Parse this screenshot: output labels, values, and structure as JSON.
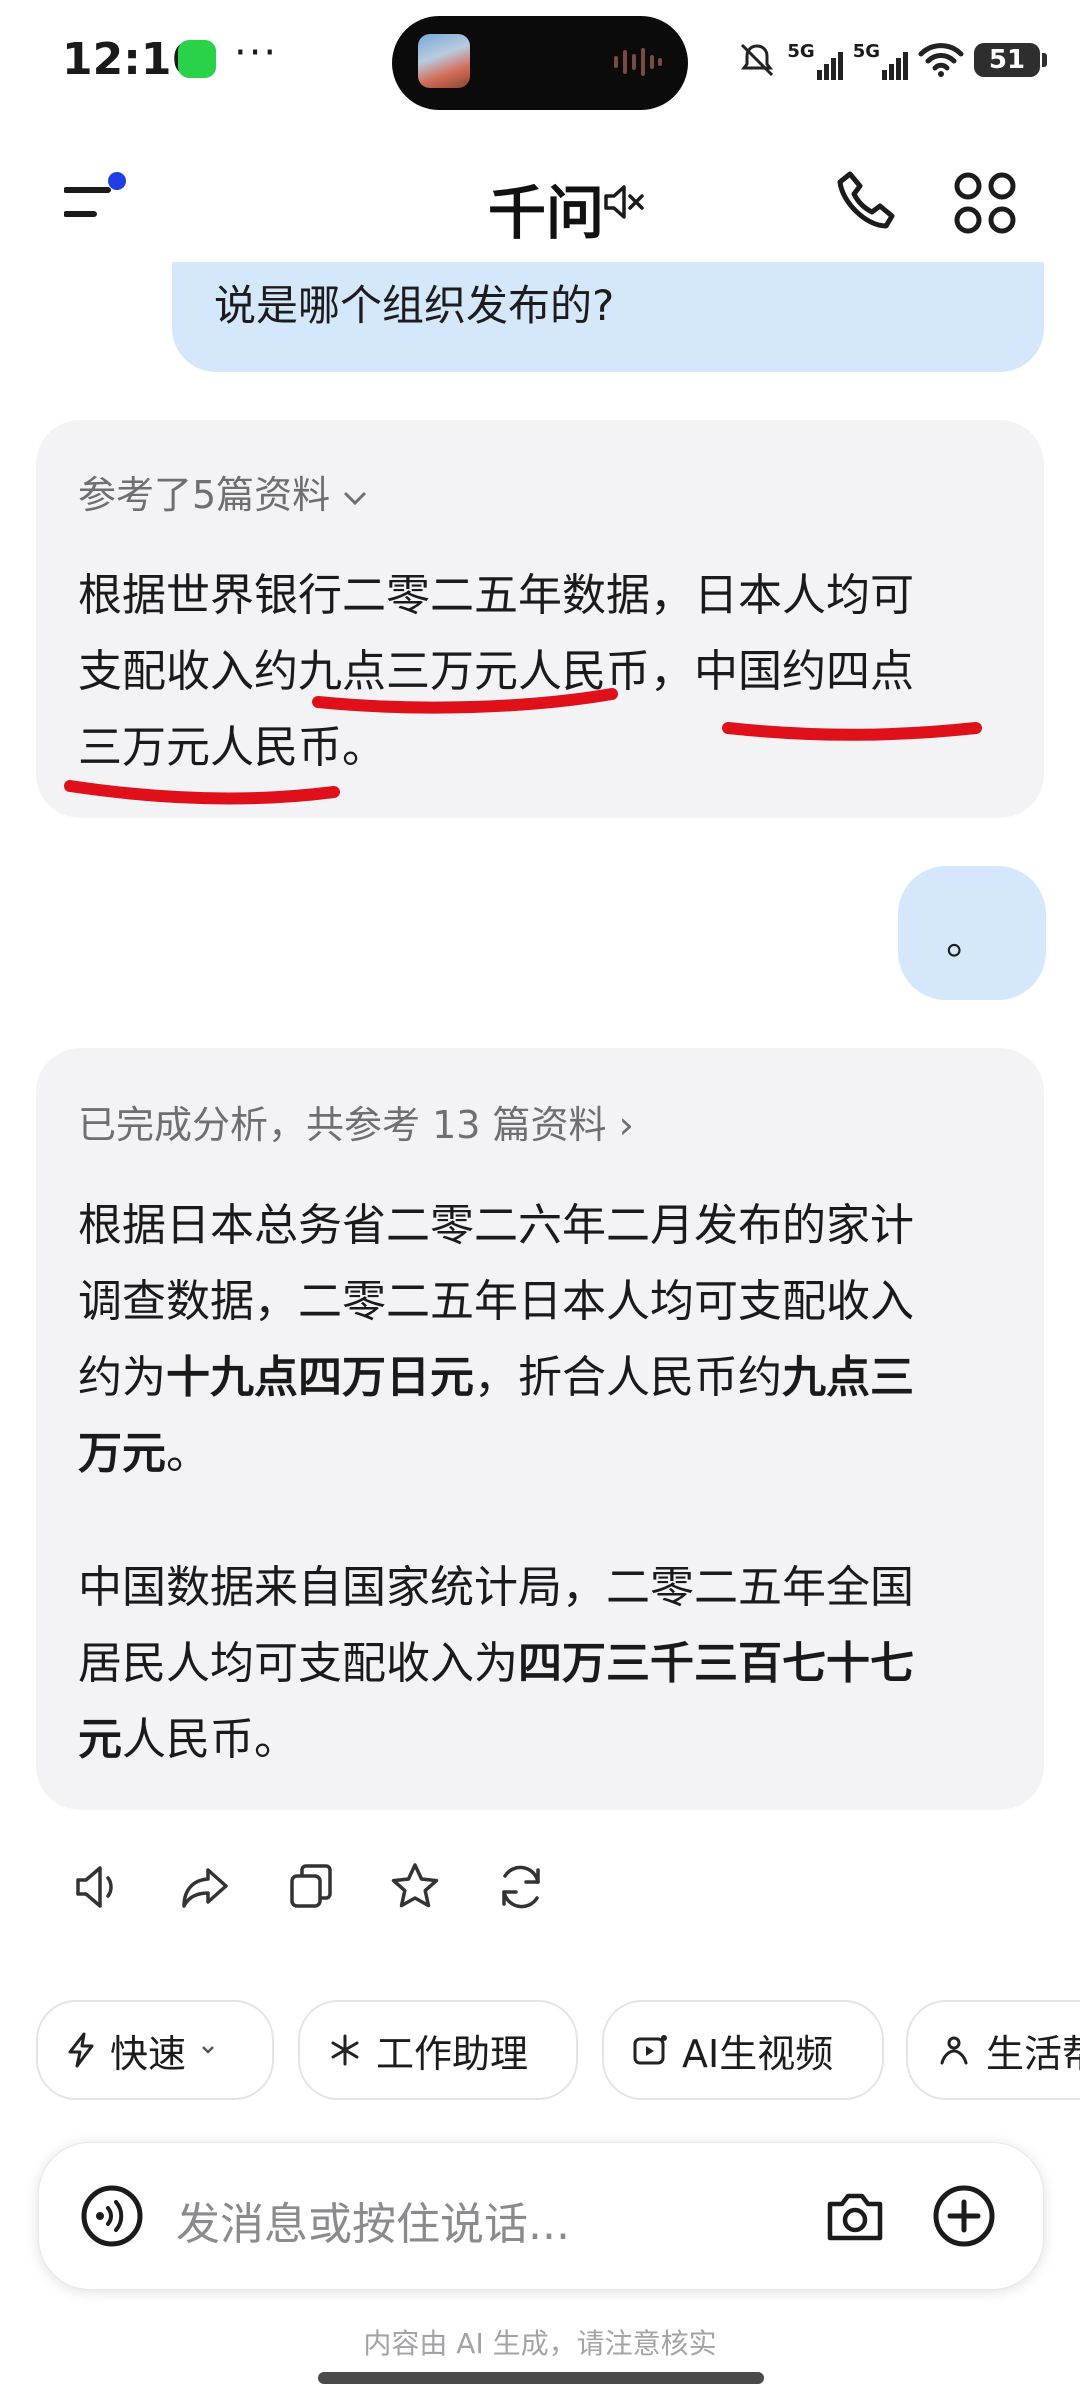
{
  "status_bar": {
    "time": "12:16",
    "dots": "···",
    "signal1": "5G",
    "signal2": "5G",
    "battery": "51"
  },
  "header": {
    "title": "千问"
  },
  "chat": {
    "user_message_1": "说是哪个组织发布的?",
    "reply_1": {
      "sources_label": "参考了5篇资料",
      "l1": "根据世界银行二零二五年数据，日本人均可",
      "l2": "支配收入约九点三万元人民币，中国约四点",
      "l3": "三万元人民币。"
    },
    "user_message_2": "。",
    "reply_2": {
      "sources_label": "已完成分析，共参考 13 篇资料 ›",
      "p1_l1": "根据日本总务省二零二六年二月发布的家计",
      "p1_l2": "调查数据，二零二五年日本人均可支配收入",
      "p1_l3a": "约为",
      "p1_l3b": "十九点四万日元",
      "p1_l3c": "，折合人民币约",
      "p1_l3d": "九点三",
      "p1_l4a": "万元",
      "p1_l4b": "。",
      "p2_l1": "中国数据来自国家统计局，二零二五年全国",
      "p2_l2a": "居民人均可支配收入为",
      "p2_l2b": "四万三千三百七十七",
      "p2_l3a": "元",
      "p2_l3b": "人民币。"
    }
  },
  "chips": [
    {
      "label": "快速",
      "icon": "lightning-icon"
    },
    {
      "label": "工作助理",
      "icon": "sparkle-icon"
    },
    {
      "label": "AI生视频",
      "icon": "video-icon"
    },
    {
      "label": "生活帮",
      "icon": "life-icon"
    }
  ],
  "input": {
    "placeholder": "发消息或按住说话..."
  },
  "disclaimer": "内容由 AI 生成，请注意核实",
  "colors": {
    "user_bubble": "#d4e7fb",
    "card": "#f3f3f5",
    "annotation_red": "#e0101a",
    "accent_dot": "#1f3fe6"
  }
}
